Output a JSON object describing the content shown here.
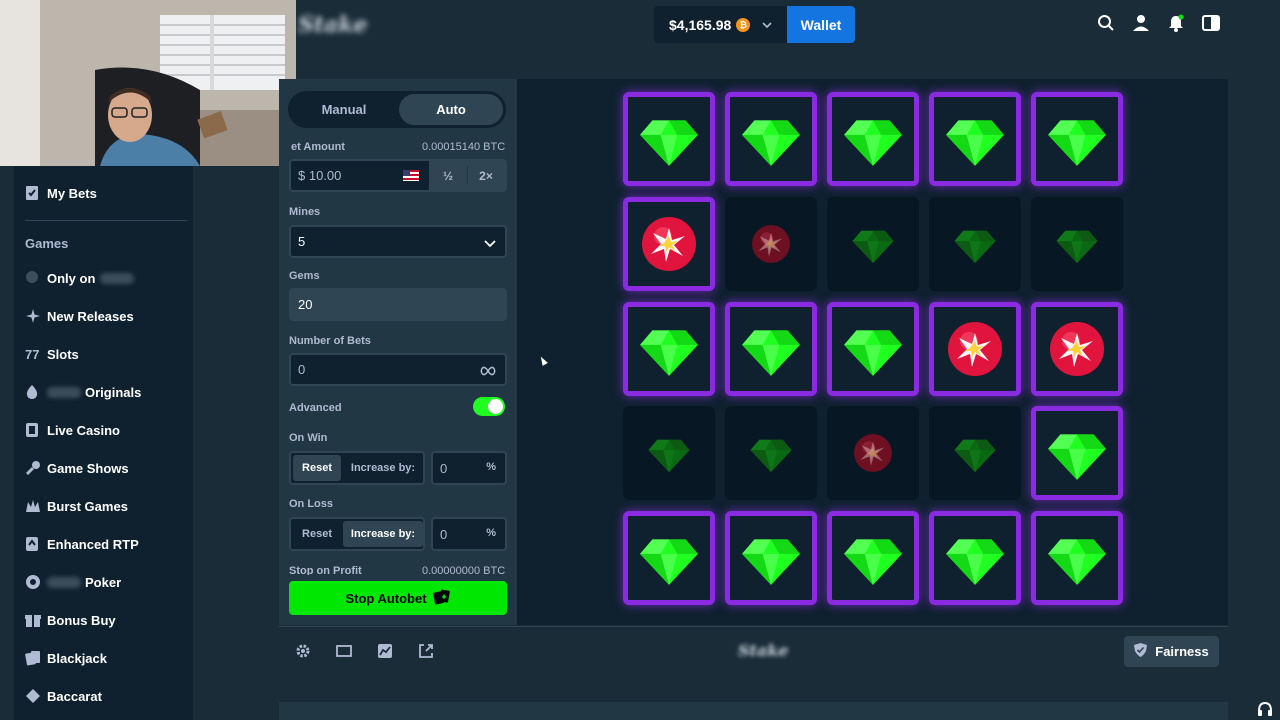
{
  "header": {
    "logo": "Stake",
    "balance": "$4,165.98",
    "wallet_label": "Wallet"
  },
  "sidebar": {
    "my_bets": "My Bets",
    "games_heading": "Games",
    "items": [
      {
        "label": "Only on",
        "icon": "stake-logo-icon"
      },
      {
        "label": "New Releases",
        "icon": "sparkle-icon"
      },
      {
        "label": "Slots",
        "icon": "slots-icon"
      },
      {
        "label": "Originals",
        "icon": "flame-icon"
      },
      {
        "label": "Live Casino",
        "icon": "live-casino-icon"
      },
      {
        "label": "Game Shows",
        "icon": "microphone-icon"
      },
      {
        "label": "Burst Games",
        "icon": "burst-icon"
      },
      {
        "label": "Enhanced RTP",
        "icon": "enhanced-rtp-icon"
      },
      {
        "label": "Poker",
        "icon": "poker-chip-icon"
      },
      {
        "label": "Bonus Buy",
        "icon": "gift-icon"
      },
      {
        "label": "Blackjack",
        "icon": "blackjack-icon"
      },
      {
        "label": "Baccarat",
        "icon": "baccarat-icon"
      }
    ]
  },
  "controls": {
    "tab_manual": "Manual",
    "tab_auto": "Auto",
    "bet_amount_label": "et Amount",
    "bet_amount_btc": "0.00015140 BTC",
    "bet_amount_value": "$ 10.00",
    "half": "½",
    "double": "2×",
    "mines_label": "Mines",
    "mines_value": "5",
    "gems_label": "Gems",
    "gems_value": "20",
    "num_bets_label": "Number of Bets",
    "num_bets_value": "0",
    "advanced_label": "Advanced",
    "advanced_on": true,
    "on_win_label": "On Win",
    "on_loss_label": "On Loss",
    "reset": "Reset",
    "increase_by": "Increase by:",
    "on_win_value": "0",
    "on_loss_value": "0",
    "percent": "%",
    "stop_profit_label": "Stop on Profit",
    "stop_profit_value": "0.00000000 BTC",
    "stop_autobet": "Stop Autobet"
  },
  "grid": {
    "rows": [
      [
        "gem-active",
        "gem-active",
        "gem-active",
        "gem-active",
        "gem-active"
      ],
      [
        "mine-active",
        "mine-revealed",
        "gem-revealed",
        "gem-revealed",
        "gem-revealed"
      ],
      [
        "gem-active",
        "gem-active",
        "gem-active",
        "mine-active",
        "mine-active"
      ],
      [
        "gem-revealed",
        "gem-revealed",
        "mine-revealed",
        "gem-revealed",
        "gem-active"
      ],
      [
        "gem-active",
        "gem-active",
        "gem-active",
        "gem-active",
        "gem-active"
      ]
    ]
  },
  "footer": {
    "logo": "Stake",
    "fairness": "Fairness"
  },
  "colors": {
    "bg": "#1a2c38",
    "panel": "#213743",
    "game_bg": "#0f212e",
    "accent_green": "#00e701",
    "gem": "#1fff20",
    "tile_border": "#8a2be2",
    "mine": "#e0143c",
    "wallet_blue": "#1475e1"
  }
}
